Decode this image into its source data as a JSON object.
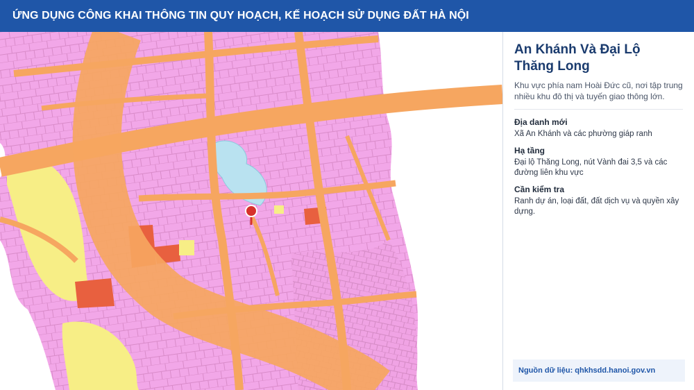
{
  "header": {
    "title": "ỨNG DỤNG CÔNG KHAI THÔNG TIN QUY HOẠCH, KẾ HOẠCH SỬ DỤNG ĐẤT HÀ NỘI"
  },
  "map": {
    "marker_icon": "map-pin-icon",
    "colors": {
      "residential": "#f2a7e8",
      "road": "#f6a660",
      "agriculture": "#f7ee86",
      "public": "#e8603f",
      "water": "#b9e2f0",
      "background": "#ffffff",
      "marker": "#d7312c"
    }
  },
  "panel": {
    "title": "An Khánh Và Đại Lộ Thăng Long",
    "description": "Khu vực phía nam Hoài Đức cũ, nơi tập trung nhiều khu đô thị và tuyến giao thông lớn.",
    "fields": [
      {
        "label": "Địa danh mới",
        "value": "Xã An Khánh và các phường giáp ranh"
      },
      {
        "label": "Hạ tầng",
        "value": "Đại lộ Thăng Long, nút Vành đai 3,5 và các đường liên khu vực"
      },
      {
        "label": "Cần kiểm tra",
        "value": "Ranh dự án, loại đất, đất dịch vụ và quyền xây dựng."
      }
    ],
    "source": "Nguồn dữ liệu: qhkhsdd.hanoi.gov.vn"
  }
}
